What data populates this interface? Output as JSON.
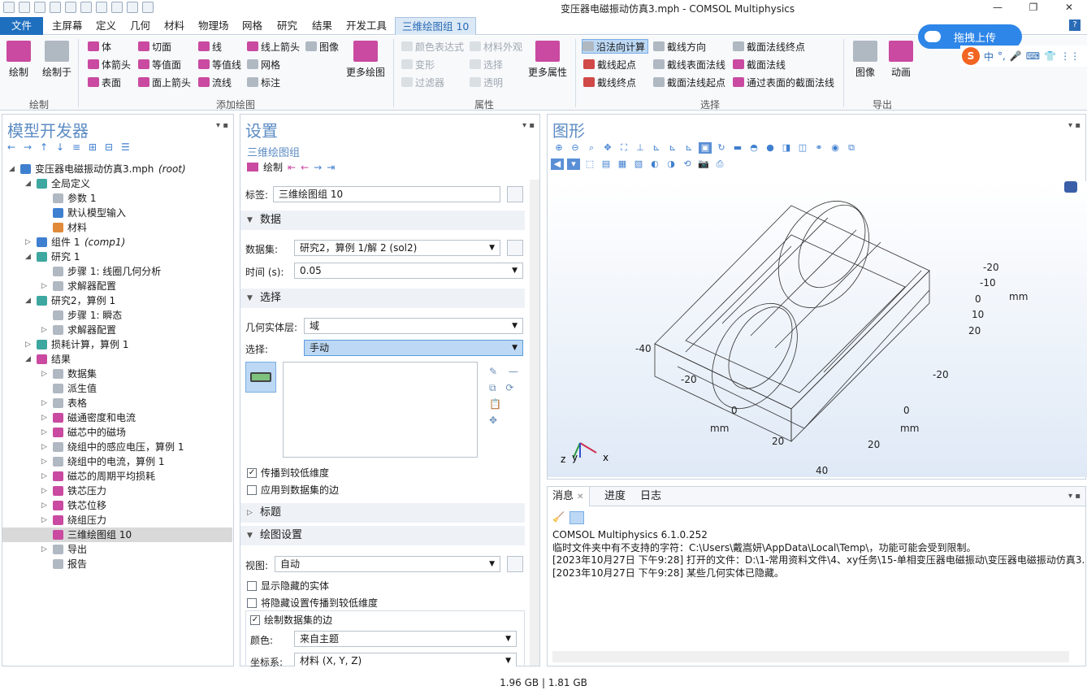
{
  "window": {
    "title": "变压器电磁振动仿真3.mph - COMSOL Multiphysics"
  },
  "menu": {
    "file": "文件",
    "tabs": [
      "主屏幕",
      "定义",
      "几何",
      "材料",
      "物理场",
      "网格",
      "研究",
      "结果",
      "开发工具"
    ],
    "context_tab": "三维绘图组 10"
  },
  "ribbon": {
    "plot_group": {
      "label": "绘制",
      "plot": "绘制",
      "plot_in": "绘制于"
    },
    "add_plot": {
      "label": "添加绘图",
      "items": [
        "体",
        "体箭头",
        "表面",
        "切面",
        "等值面",
        "面上箭头",
        "线",
        "等值线",
        "流线",
        "线上箭头",
        "网格",
        "标注",
        "图像"
      ],
      "more": "更多绘图"
    },
    "attributes": {
      "label": "属性",
      "items": [
        "颜色表达式",
        "变形",
        "过滤器",
        "材料外观",
        "选择",
        "透明"
      ],
      "more": "更多属性"
    },
    "select": {
      "label": "选择",
      "items": [
        "沿法向计算",
        "截线起点",
        "截线终点",
        "截线方向",
        "截线表面法线",
        "截面法线起点",
        "截面法线终点",
        "截面法线",
        "通过表面的截面法线"
      ]
    },
    "export": {
      "label": "导出",
      "image": "图像",
      "animation": "动画"
    }
  },
  "overlay": {
    "upload": "拖拽上传",
    "ime": [
      "中",
      "°,",
      "🎤",
      "⌨",
      "👕",
      "⋮⋮"
    ]
  },
  "model_builder": {
    "title": "模型开发器",
    "tree": [
      {
        "label": "变压器电磁振动仿真3.mph",
        "suffix": "(root)",
        "level": 0,
        "toggle": "◢",
        "icon": "blue"
      },
      {
        "label": "全局定义",
        "level": 1,
        "toggle": "◢",
        "icon": "teal"
      },
      {
        "label": "参数 1",
        "level": 2,
        "toggle": "",
        "icon": "grey"
      },
      {
        "label": "默认模型输入",
        "level": 2,
        "toggle": "",
        "icon": "blue"
      },
      {
        "label": "材料",
        "level": 2,
        "toggle": "",
        "icon": "orange"
      },
      {
        "label": "组件 1",
        "suffix": "(comp1)",
        "level": 1,
        "toggle": "▷",
        "icon": "blue"
      },
      {
        "label": "研究 1",
        "level": 1,
        "toggle": "◢",
        "icon": "teal"
      },
      {
        "label": "步骤 1: 线圈几何分析",
        "level": 2,
        "toggle": "",
        "icon": "grey"
      },
      {
        "label": "求解器配置",
        "level": 2,
        "toggle": "▷",
        "icon": "grey"
      },
      {
        "label": "研究2，算例 1",
        "level": 1,
        "toggle": "◢",
        "icon": "teal"
      },
      {
        "label": "步骤 1: 瞬态",
        "level": 2,
        "toggle": "",
        "icon": "grey"
      },
      {
        "label": "求解器配置",
        "level": 2,
        "toggle": "▷",
        "icon": "grey"
      },
      {
        "label": "损耗计算，算例 1",
        "level": 1,
        "toggle": "▷",
        "icon": "teal"
      },
      {
        "label": "结果",
        "level": 1,
        "toggle": "◢",
        "icon": "pink"
      },
      {
        "label": "数据集",
        "level": 2,
        "toggle": "▷",
        "icon": "grey"
      },
      {
        "label": "派生值",
        "level": 2,
        "toggle": "",
        "icon": "grey"
      },
      {
        "label": "表格",
        "level": 2,
        "toggle": "▷",
        "icon": "grey"
      },
      {
        "label": "磁通密度和电流",
        "level": 2,
        "toggle": "▷",
        "icon": "pink"
      },
      {
        "label": "磁芯中的磁场",
        "level": 2,
        "toggle": "▷",
        "icon": "pink"
      },
      {
        "label": "绕组中的感应电压，算例 1",
        "level": 2,
        "toggle": "▷",
        "icon": "grey"
      },
      {
        "label": "绕组中的电流，算例 1",
        "level": 2,
        "toggle": "▷",
        "icon": "grey"
      },
      {
        "label": "磁芯的周期平均损耗",
        "level": 2,
        "toggle": "▷",
        "icon": "pink"
      },
      {
        "label": "铁芯压力",
        "level": 2,
        "toggle": "▷",
        "icon": "pink"
      },
      {
        "label": "铁芯位移",
        "level": 2,
        "toggle": "▷",
        "icon": "pink"
      },
      {
        "label": "绕组压力",
        "level": 2,
        "toggle": "▷",
        "icon": "pink"
      },
      {
        "label": "三维绘图组 10",
        "level": 2,
        "toggle": "",
        "icon": "pink",
        "selected": true
      },
      {
        "label": "导出",
        "level": 2,
        "toggle": "▷",
        "icon": "grey"
      },
      {
        "label": "报告",
        "level": 2,
        "toggle": "",
        "icon": "grey"
      }
    ]
  },
  "settings": {
    "title": "设置",
    "subtitle": "三维绘图组",
    "plot_button": "绘制",
    "label_field": {
      "label": "标签:",
      "value": "三维绘图组 10"
    },
    "data_section": "数据",
    "dataset": {
      "label": "数据集:",
      "value": "研究2，算例 1/解 2 (sol2)"
    },
    "time": {
      "label": "时间 (s):",
      "value": "0.05"
    },
    "selection_section": "选择",
    "geom_level": {
      "label": "几何实体层:",
      "value": "域"
    },
    "selection": {
      "label": "选择:",
      "value": "手动"
    },
    "propagate": {
      "label": "传播到较低维度",
      "checked": true
    },
    "apply_edges": {
      "label": "应用到数据集的边",
      "checked": false
    },
    "title_section": "标题",
    "plot_settings_section": "绘图设置",
    "view": {
      "label": "视图:",
      "value": "自动"
    },
    "show_hidden": {
      "label": "显示隐藏的实体",
      "checked": false
    },
    "propagate_hidden": {
      "label": "将隐藏设置传播到较低维度",
      "checked": false
    },
    "plot_edges": {
      "label": "绘制数据集的边",
      "checked": true
    },
    "color": {
      "label": "颜色:",
      "value": "来自主题"
    },
    "coord": {
      "label": "坐标系:",
      "value": "材料 (X, Y, Z)"
    }
  },
  "graphics": {
    "title": "图形",
    "axis_labels": {
      "right_ticks": [
        "-20",
        "-10",
        "0",
        "10",
        "20"
      ],
      "right_unit": "mm",
      "left_ticks": [
        "-40",
        "-20",
        "0",
        "20",
        "40"
      ],
      "left_unit": "mm",
      "mid_ticks": [
        "-20",
        "0",
        "20"
      ],
      "mid_unit": "mm"
    },
    "triad": {
      "z": "z",
      "y": "y",
      "x": "x"
    }
  },
  "messages": {
    "tabs": [
      "消息",
      "进度",
      "日志"
    ],
    "lines": [
      "COMSOL Multiphysics 6.1.0.252",
      "临时文件夹中有不支持的字符：C:\\Users\\戴嵩妍\\AppData\\Local\\Temp\\，功能可能会受到限制。",
      "[2023年10月27日 下午9:28] 打开的文件：D:\\1-常用资料文件\\4、xy任务\\15-单相变压器电磁振动\\变压器电磁振动仿真3.",
      "[2023年10月27日 下午9:28] 某些几何实体已隐藏。"
    ]
  },
  "status": {
    "memory": "1.96 GB | 1.81 GB"
  }
}
